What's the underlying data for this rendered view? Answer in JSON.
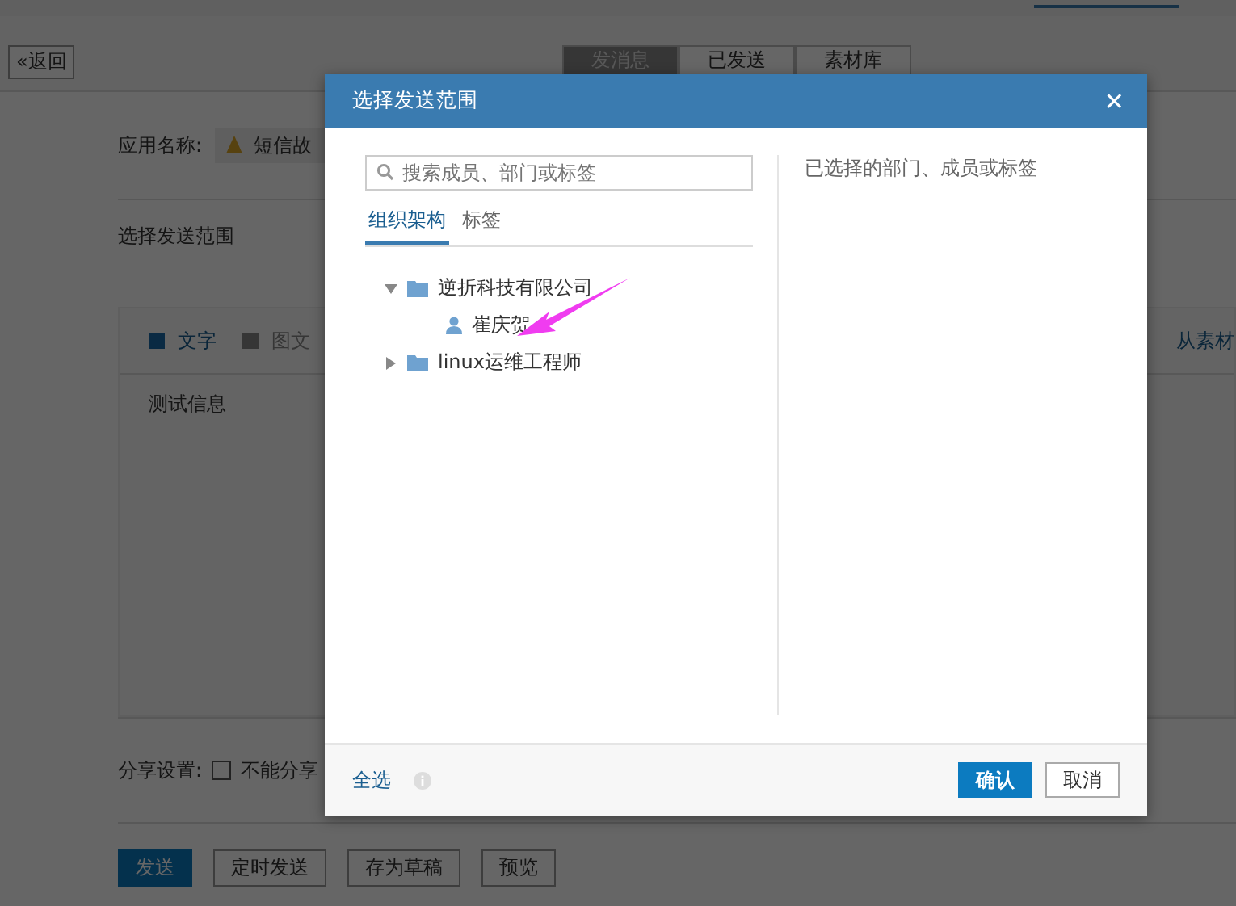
{
  "page": {
    "back_button": "«返回",
    "tabs": [
      {
        "label": "发消息",
        "selected": true
      },
      {
        "label": "已发送",
        "selected": false
      },
      {
        "label": "素材库",
        "selected": false
      }
    ],
    "app_label": "应用名称:",
    "app_name": "短信故",
    "scope_label": "选择发送范围",
    "editor": {
      "types": [
        {
          "label": "文字",
          "selected": true
        },
        {
          "label": "图文",
          "selected": false
        }
      ],
      "from_library": "从素材",
      "content": "测试信息"
    },
    "share": {
      "label": "分享设置:",
      "option": "不能分享",
      "checked": false
    },
    "actions": [
      {
        "label": "发送",
        "kind": "primary"
      },
      {
        "label": "定时发送",
        "kind": "default"
      },
      {
        "label": "存为草稿",
        "kind": "default"
      },
      {
        "label": "预览",
        "kind": "default"
      }
    ]
  },
  "dialog": {
    "title": "选择发送范围",
    "close": "✕",
    "search": {
      "placeholder": "搜索成员、部门或标签"
    },
    "tabs": [
      {
        "label": "组织架构",
        "selected": true
      },
      {
        "label": "标签",
        "selected": false
      }
    ],
    "tree": [
      {
        "kind": "folder",
        "label": "逆折科技有限公司",
        "expanded": true,
        "children": [
          {
            "kind": "person",
            "label": "崔庆贺"
          }
        ]
      },
      {
        "kind": "folder",
        "label": "linux运维工程师",
        "expanded": false
      }
    ],
    "selected_hint": "已选择的部门、成员或标签",
    "select_all": "全选",
    "confirm": "确认",
    "cancel": "取消"
  }
}
